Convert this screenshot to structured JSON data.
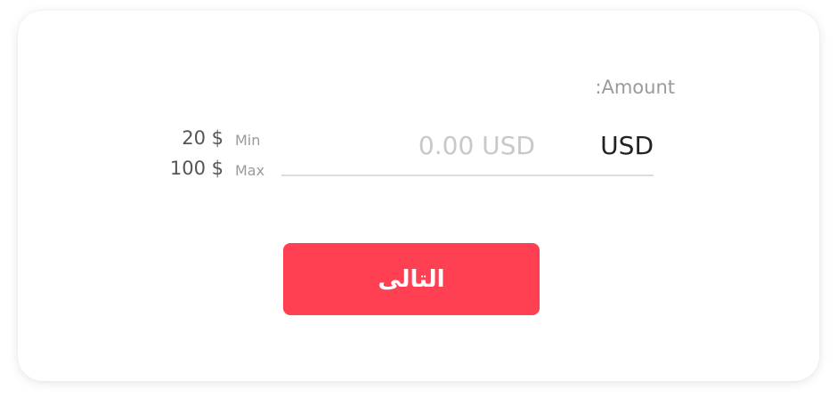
{
  "form": {
    "amount_label": ":Amount",
    "currency": "USD",
    "input_value": "",
    "input_placeholder": "0.00 USD"
  },
  "limits": {
    "min_label": "Min",
    "min_value": "20 $",
    "max_label": "Max",
    "max_value": "100 $"
  },
  "actions": {
    "next_label": "التالى",
    "next_color": "#ff4052"
  }
}
